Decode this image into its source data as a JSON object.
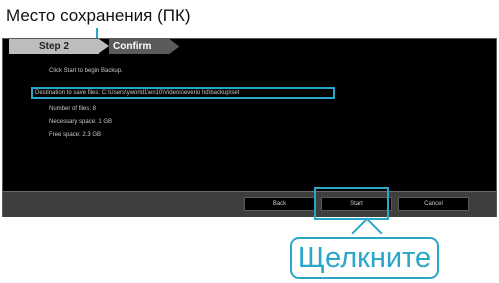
{
  "annotation": {
    "top_label": "Место сохранения (ПК)",
    "click_label": "Щелкните"
  },
  "steps": {
    "previous": "Step 2",
    "current": "Confirm"
  },
  "info": {
    "line1": "Click Start to begin Backup.",
    "line2": "Destination to save files: C:\\Users\\yworld1\\en10\\Videos\\everio hd\\backup\\set",
    "line3": "Number of files: 8",
    "line4": "Necessary space: 1 GB",
    "line5": "Free space: 2.3 GB"
  },
  "buttons": {
    "back": "Back",
    "start": "Start",
    "cancel": "Cancel"
  },
  "colors": {
    "accent": "#2aa6c8",
    "dialog_bg": "#000000",
    "bar_bg": "#3e3e3e"
  }
}
